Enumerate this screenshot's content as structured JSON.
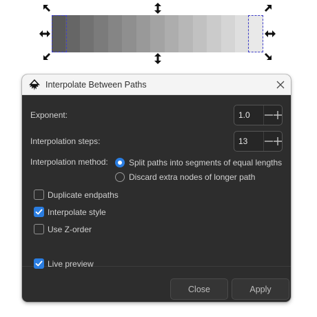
{
  "canvas": {
    "gradient_colors": [
      "#5a5a5a",
      "#666666",
      "#717171",
      "#7b7b7b",
      "#858585",
      "#8f8f8f",
      "#999999",
      "#a3a3a3",
      "#adadad",
      "#b7b7b7",
      "#c1c1c1",
      "#cbcbcb",
      "#d5d5d5",
      "#dfdfdf",
      "#e9e9e9"
    ],
    "selection_color": "#3c3cc8"
  },
  "dialog": {
    "title": "Interpolate Between Paths",
    "icons": {
      "app": "inkscape-logo-icon",
      "close": "close-icon"
    },
    "exponent": {
      "label": "Exponent:",
      "value": "1.0"
    },
    "steps": {
      "label": "Interpolation steps:",
      "value": "13"
    },
    "method": {
      "label": "Interpolation method:",
      "options": [
        {
          "label": "Split paths into segments of equal lengths",
          "selected": true
        },
        {
          "label": "Discard extra nodes of longer path",
          "selected": false
        }
      ]
    },
    "checkboxes": [
      {
        "label": "Duplicate endpaths",
        "checked": false
      },
      {
        "label": "Interpolate style",
        "checked": true
      },
      {
        "label": "Use Z-order",
        "checked": false
      }
    ],
    "live_preview": {
      "label": "Live preview",
      "checked": true
    },
    "buttons": {
      "close": "Close",
      "apply": "Apply"
    },
    "accent_color": "#2a7de1"
  }
}
